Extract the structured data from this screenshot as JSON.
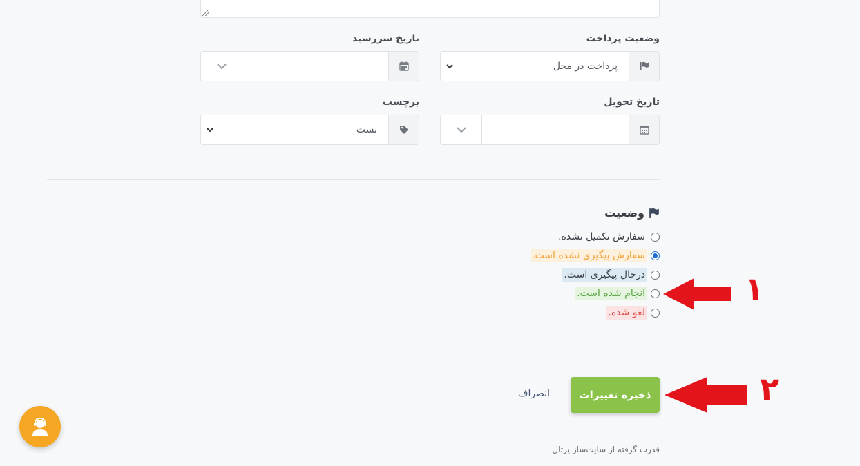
{
  "fields": {
    "due_date": {
      "label": "تاریخ سررسید",
      "value": ""
    },
    "payment_status": {
      "label": "وضعیت پرداخت",
      "value": "پرداخت در محل"
    },
    "tag": {
      "label": "برچسب",
      "value": "تست"
    },
    "delivery_date": {
      "label": "تاریخ تحویل",
      "value": ""
    }
  },
  "status": {
    "title": "وضعیت",
    "options": [
      {
        "label": "سفارش تکمیل نشده.",
        "checked": false,
        "bg": "transparent",
        "color": "#3c4148"
      },
      {
        "label": "سفارش پیگیری نشده است.",
        "checked": true,
        "bg": "#fdf0dc",
        "color": "#f0a43a"
      },
      {
        "label": "درحال پیگیری است.",
        "checked": false,
        "bg": "#dbe9f3",
        "color": "#3c4148"
      },
      {
        "label": "انجام شده است.",
        "checked": false,
        "bg": "#e4f4de",
        "color": "#5aa446"
      },
      {
        "label": "لغو شده.",
        "checked": false,
        "bg": "#fbe3e3",
        "color": "#d9534f"
      }
    ]
  },
  "actions": {
    "save_label": "ذخیره تغییرات",
    "cancel_label": "انصراف"
  },
  "footer": {
    "text": "قدرت گرفته از سایت‌ساز پرتال"
  },
  "annotations": {
    "one": "١",
    "two": "٢",
    "color": "#e3141b"
  },
  "icons": {
    "calendar": "calendar-icon",
    "flag": "flag-icon",
    "tag": "tag-icon",
    "chevron": "chevron-down-icon",
    "support": "support-agent-icon"
  },
  "colors": {
    "save_button": "#8bc34a",
    "support_button": "#f5a623",
    "radio_checked": "#1f6fd6"
  }
}
